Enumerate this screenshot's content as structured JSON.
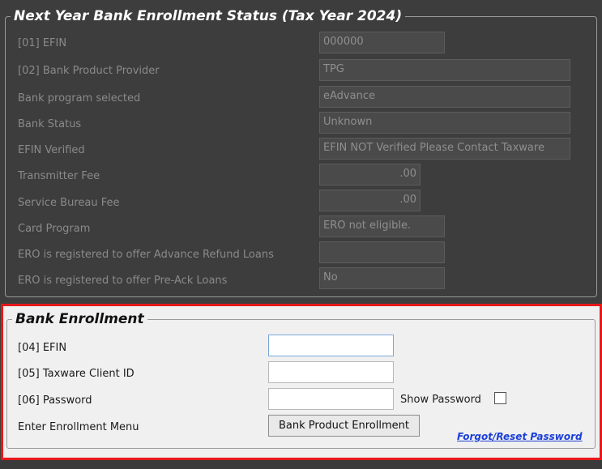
{
  "status_section": {
    "title": "Next Year Bank Enrollment Status (Tax Year 2024)",
    "rows": [
      {
        "label": "[01] EFIN",
        "value": "000000"
      },
      {
        "label": "[02] Bank Product Provider",
        "value": "TPG"
      },
      {
        "label": "Bank program selected",
        "value": "eAdvance"
      },
      {
        "label": "Bank Status",
        "value": "Unknown"
      },
      {
        "label": "EFIN Verified",
        "value": "EFIN NOT Verified Please Contact Taxware"
      },
      {
        "label": "Transmitter Fee",
        "value": ".00"
      },
      {
        "label": "Service Bureau Fee",
        "value": ".00"
      },
      {
        "label": "Card Program",
        "value": "ERO not eligible."
      },
      {
        "label": "ERO is registered to offer Advance Refund Loans",
        "value": ""
      },
      {
        "label": "ERO is registered to offer Pre-Ack Loans",
        "value": "No"
      }
    ]
  },
  "enrollment_section": {
    "title": "Bank Enrollment",
    "efin_label": "[04] EFIN",
    "efin_value": "",
    "client_id_label": "[05] Taxware Client ID",
    "client_id_value": "",
    "password_label": "[06] Password",
    "password_value": "",
    "show_password_label": "Show Password",
    "show_password_checked": false,
    "menu_label": "Enter Enrollment Menu",
    "enroll_button_label": "Bank Product Enrollment",
    "forgot_link_label": "Forgot/Reset Password"
  },
  "colors": {
    "highlight_border": "#e8181b",
    "link": "#1b3fd8"
  }
}
